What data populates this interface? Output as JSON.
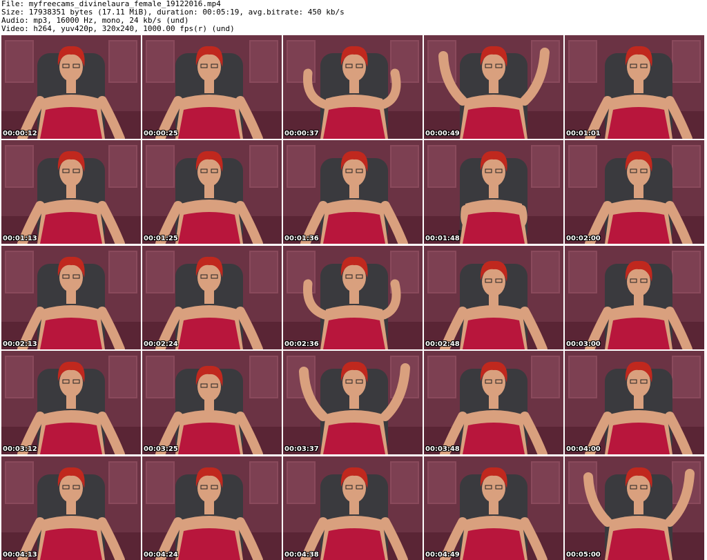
{
  "header": {
    "lines": [
      "File: myfreecams_divinelaura_female_19122016.mp4",
      "Size: 17938351 bytes (17.11 MiB), duration: 00:05:19, avg.bitrate: 450 kb/s",
      "Audio: mp3, 16000 Hz, mono, 24 kb/s (und)",
      "Video: h264, yuv420p, 320x240, 1000.00 fps(r) (und)"
    ]
  },
  "grid": {
    "columns": 5,
    "rows": 5
  },
  "thumbnails": [
    {
      "timestamp": "00:00:12",
      "pose": "neutral"
    },
    {
      "timestamp": "00:00:25",
      "pose": "neutral"
    },
    {
      "timestamp": "00:00:37",
      "pose": "hands-up-low"
    },
    {
      "timestamp": "00:00:49",
      "pose": "arms-raised"
    },
    {
      "timestamp": "00:01:01",
      "pose": "neutral"
    },
    {
      "timestamp": "00:01:13",
      "pose": "neutral"
    },
    {
      "timestamp": "00:01:25",
      "pose": "neutral"
    },
    {
      "timestamp": "00:01:36",
      "pose": "neutral"
    },
    {
      "timestamp": "00:01:48",
      "pose": "typing"
    },
    {
      "timestamp": "00:02:00",
      "pose": "neutral"
    },
    {
      "timestamp": "00:02:13",
      "pose": "neutral"
    },
    {
      "timestamp": "00:02:24",
      "pose": "neutral"
    },
    {
      "timestamp": "00:02:36",
      "pose": "hands-up-low"
    },
    {
      "timestamp": "00:02:48",
      "pose": "looking-down"
    },
    {
      "timestamp": "00:03:00",
      "pose": "looking-down"
    },
    {
      "timestamp": "00:03:12",
      "pose": "neutral"
    },
    {
      "timestamp": "00:03:25",
      "pose": "looking-down"
    },
    {
      "timestamp": "00:03:37",
      "pose": "arms-raised"
    },
    {
      "timestamp": "00:03:48",
      "pose": "neutral"
    },
    {
      "timestamp": "00:04:00",
      "pose": "neutral"
    },
    {
      "timestamp": "00:04:13",
      "pose": "neutral"
    },
    {
      "timestamp": "00:04:24",
      "pose": "neutral"
    },
    {
      "timestamp": "00:04:38",
      "pose": "neutral"
    },
    {
      "timestamp": "00:04:49",
      "pose": "neutral"
    },
    {
      "timestamp": "00:05:00",
      "pose": "arms-raised"
    }
  ],
  "colors": {
    "wall": "#6b3344",
    "wall_panel": "#7d4052",
    "chair": "#3a3a3e",
    "hair": "#c0281e",
    "skin": "#d9a07e",
    "top": "#b8163c",
    "timestamp_text": "#ffffff"
  }
}
